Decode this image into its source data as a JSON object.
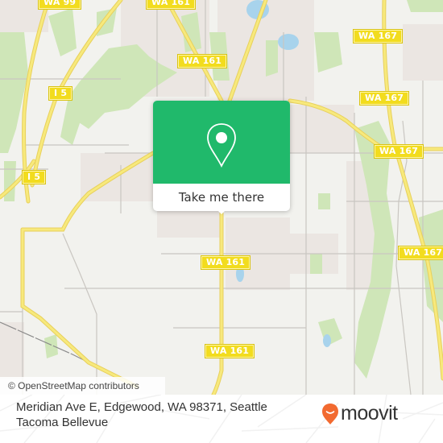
{
  "map": {
    "attribution": "© OpenStreetMap contributors",
    "road_shields": [
      {
        "label": "WA 99",
        "id": "wa99-top"
      },
      {
        "label": "WA 161",
        "id": "wa161-top"
      },
      {
        "label": "WA 167",
        "id": "wa167-top"
      },
      {
        "label": "WA 161",
        "id": "wa161-upper"
      },
      {
        "label": "I 5",
        "id": "i5-upper"
      },
      {
        "label": "WA 167",
        "id": "wa167-mid"
      },
      {
        "label": "WA 167",
        "id": "wa167-right"
      },
      {
        "label": "I 5",
        "id": "i5-lower"
      },
      {
        "label": "WA 167",
        "id": "wa167-lower"
      },
      {
        "label": "WA 161",
        "id": "wa161-mid"
      },
      {
        "label": "WA 161",
        "id": "wa161-bottom"
      }
    ],
    "popup": {
      "icon": "location-pin-icon",
      "button_label": "Take me there",
      "color": "#20b96b"
    }
  },
  "footer": {
    "address": "Meridian Ave E, Edgewood, WA 98371, Seattle Tacoma Bellevue",
    "brand": "moovit",
    "brand_color": "#f26a30"
  }
}
